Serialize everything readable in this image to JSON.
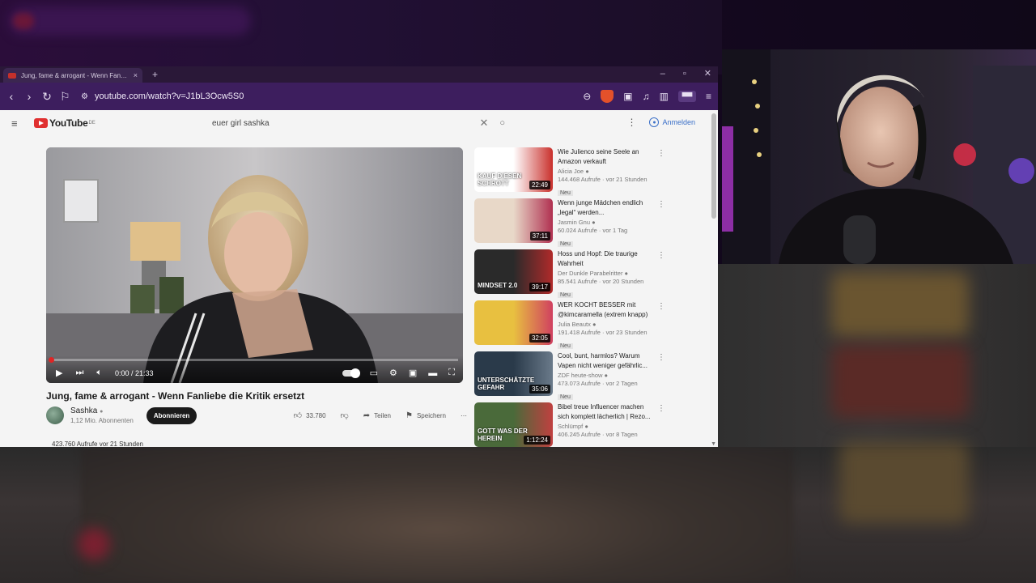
{
  "browser": {
    "tab_title": "Jung, fame & arrogant - Wenn Fanliebe die Kritik ersetzt",
    "url": "youtube.com/watch?v=J1bL3Ocw5S0",
    "new_tab": "+",
    "tab_close": "×"
  },
  "youtube": {
    "logo_text": "YouTube",
    "region": "DE",
    "search_query": "euer girl sashka",
    "signin_label": "Anmelden"
  },
  "player": {
    "time": "0:00 / 21:33",
    "progress_fraction": 0.0
  },
  "video": {
    "title": "Jung, fame & arrogant - Wenn Fanliebe die Kritik ersetzt",
    "channel": "Sashka",
    "subscribers": "1,12 Mio. Abonnenten",
    "subscribe_label": "Abonnieren",
    "likes": "33.780",
    "share_label": "Teilen",
    "save_label": "Speichern",
    "views": "423.760 Aufrufe  vor 21 Stunden"
  },
  "recommendations": [
    {
      "title": "Wie Julienco seine Seele an Amazon verkauft",
      "channel": "Alicia Joe",
      "meta": "144.468 Aufrufe · vor 21 Stunden",
      "badge": "Neu",
      "duration": "22:49",
      "thumb_text": "KAUF DIESEN SCHROTT",
      "colors": [
        "#ffffff",
        "#c9302c"
      ]
    },
    {
      "title": "Wenn junge Mädchen endlich „legal“ werden...",
      "channel": "Jasmin Gnu",
      "meta": "60.024 Aufrufe · vor 1 Tag",
      "badge": "Neu",
      "duration": "37:11",
      "thumb_text": "",
      "colors": [
        "#e8d8c8",
        "#b03050"
      ]
    },
    {
      "title": "Hoss und Hopf: Die traurige Wahrheit",
      "channel": "Der Dunkle Parabelritter",
      "meta": "85.541 Aufrufe · vor 20 Stunden",
      "badge": "Neu",
      "duration": "39:17",
      "thumb_text": "MINDSET 2.0",
      "colors": [
        "#2a2a2a",
        "#b02a2a"
      ]
    },
    {
      "title": "WER KOCHT BESSER mit @kimcaramella (extrem knapp)",
      "channel": "Julia Beautx",
      "meta": "191.418 Aufrufe · vor 23 Stunden",
      "badge": "Neu",
      "duration": "32:05",
      "thumb_text": "",
      "colors": [
        "#e8c040",
        "#d04060"
      ]
    },
    {
      "title": "Cool, bunt, harmlos? Warum Vapen nicht weniger gefährlic...",
      "channel": "ZDF heute-show",
      "meta": "473.073 Aufrufe · vor 2 Tagen",
      "badge": "Neu",
      "duration": "35:06",
      "thumb_text": "UNTERSCHÄTZTE GEFAHR",
      "colors": [
        "#2a3a4a",
        "#6a7a8a"
      ]
    },
    {
      "title": "Bibel treue Influencer machen sich komplett lächerlich | Rezo...",
      "channel": "Schlümpf",
      "meta": "406.245 Aufrufe · vor 8 Tagen",
      "badge": "",
      "duration": "1:12:24",
      "thumb_text": "GOTT WAS DER HEREIN",
      "colors": [
        "#4a6a3a",
        "#c04040"
      ]
    }
  ]
}
